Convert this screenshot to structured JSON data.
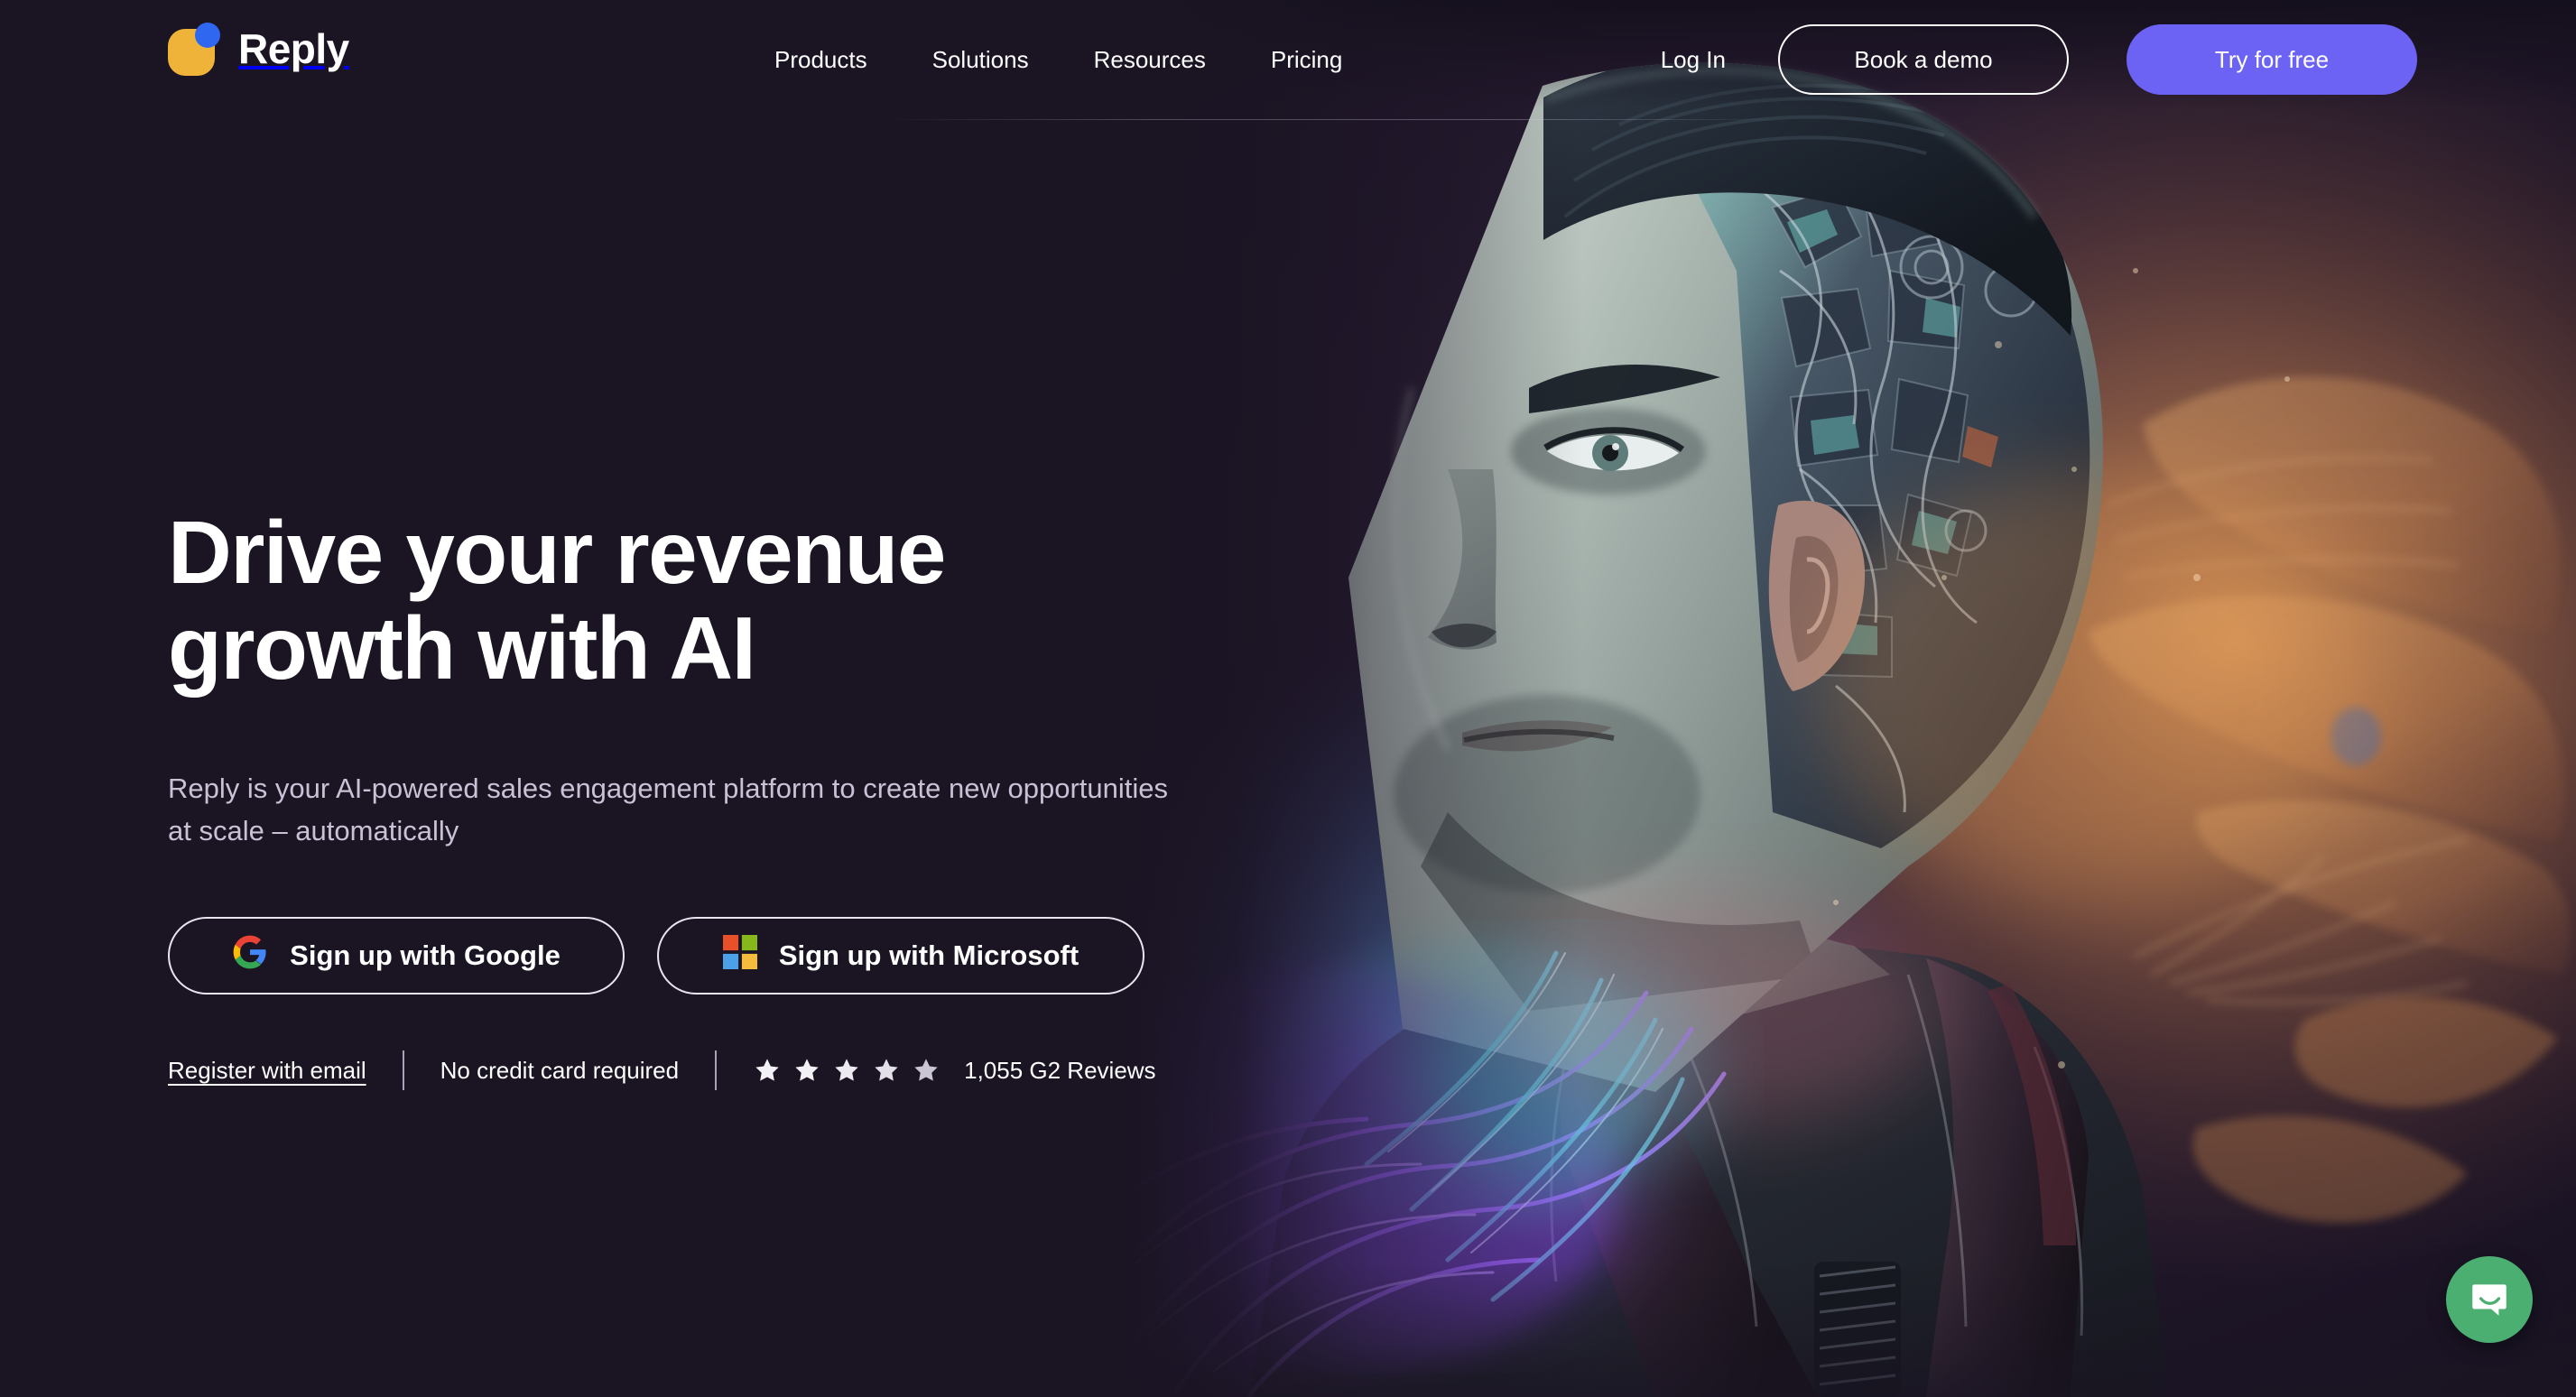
{
  "brand": {
    "name": "Reply",
    "logo_square_color": "#eeb338",
    "logo_dot_color": "#2f67f0"
  },
  "header": {
    "nav": [
      {
        "label": "Products"
      },
      {
        "label": "Solutions"
      },
      {
        "label": "Resources"
      },
      {
        "label": "Pricing"
      }
    ],
    "login_label": "Log In",
    "demo_label": "Book a demo",
    "try_label": "Try for free",
    "accent_color": "#6c63f4"
  },
  "hero": {
    "headline_line1": "Drive your revenue",
    "headline_line2": "growth with AI",
    "subhead": "Reply is your AI-powered sales engagement platform to create new opportunities at scale – automatically",
    "signup_google_label": "Sign up with Google",
    "signup_microsoft_label": "Sign up with Microsoft",
    "register_email_label": "Register with email",
    "no_credit_card_label": "No credit card required",
    "reviews_label": "1,055 G2 Reviews",
    "star_count": 5,
    "background_color": "#1a1423"
  },
  "chat": {
    "icon": "chat-bubble-icon",
    "color": "#4caf72"
  },
  "icons": {
    "google": "google-icon",
    "microsoft": "microsoft-icon",
    "star": "star-icon"
  }
}
